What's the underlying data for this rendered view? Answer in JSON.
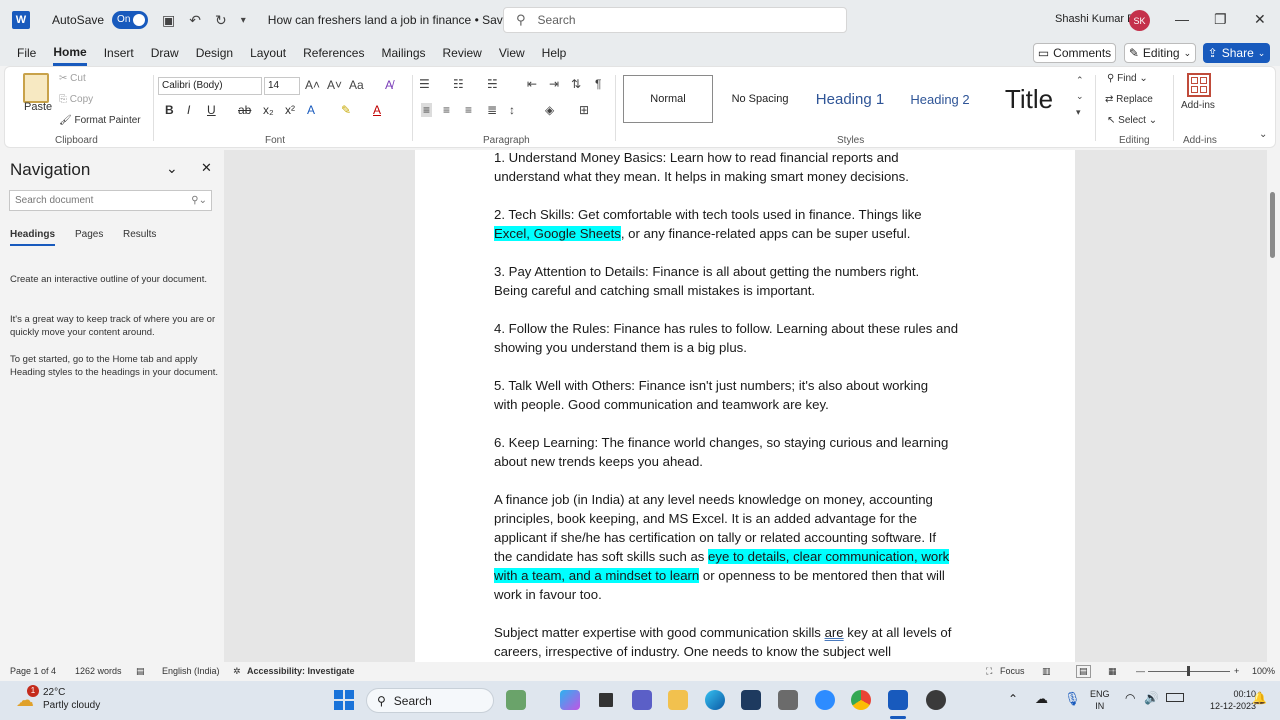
{
  "titlebar": {
    "app_icon": "W",
    "autosave_label": "AutoSave",
    "autosave_state": "On",
    "document_title": "How can freshers land a job in finance • Saved ⌄",
    "search_placeholder": "Search",
    "user_name": "Shashi Kumar E",
    "user_initials": "SK"
  },
  "menu": {
    "tabs": [
      "File",
      "Home",
      "Insert",
      "Draw",
      "Design",
      "Layout",
      "References",
      "Mailings",
      "Review",
      "View",
      "Help"
    ],
    "active": "Home",
    "comments": "Comments",
    "editing": "Editing",
    "share": "Share"
  },
  "ribbon": {
    "clipboard": {
      "paste": "Paste",
      "cut": "Cut",
      "copy": "Copy",
      "format_painter": "Format Painter",
      "label": "Clipboard"
    },
    "font": {
      "name": "Calibri (Body)",
      "size": "14",
      "label": "Font"
    },
    "paragraph": {
      "label": "Paragraph"
    },
    "styles": {
      "items": [
        "Normal",
        "No Spacing",
        "Heading 1",
        "Heading 2",
        "Title"
      ],
      "label": "Styles"
    },
    "editing": {
      "find": "Find",
      "replace": "Replace",
      "select": "Select",
      "label": "Editing"
    },
    "addins": {
      "button": "Add-ins",
      "label": "Add-ins"
    }
  },
  "navigation": {
    "title": "Navigation",
    "search_placeholder": "Search document",
    "tabs": [
      "Headings",
      "Pages",
      "Results"
    ],
    "paragraphs": [
      "Create an interactive outline of your document.",
      "It's a great way to keep track of where you are or quickly move your content around.",
      "To get started, go to the Home tab and apply Heading styles to the headings in your document."
    ]
  },
  "document": {
    "p1": [
      "1. Understand Money Basics: Learn how to read financial reports and",
      "understand what they mean. It helps in making smart money decisions."
    ],
    "p2_line1": "2. Tech Skills: Get comfortable with tech tools used in finance. Things like",
    "p2_hl": "Excel, Google Sheets",
    "p2_rest": ", or any finance-related apps can be super useful.",
    "p3": [
      "3. Pay Attention to Details: Finance is all about getting the numbers right.",
      "Being careful and catching small mistakes is important."
    ],
    "p4": [
      "4. Follow the Rules: Finance has rules to follow. Learning about these rules and",
      "showing you understand them is a big plus."
    ],
    "p5": [
      "5. Talk Well with Others: Finance isn't just numbers; it's also about working",
      "with people. Good communication and teamwork are key."
    ],
    "p6": [
      "6. Keep Learning: The finance world changes, so staying curious and learning",
      "about new trends keeps you ahead."
    ],
    "p7_lines": [
      "A finance job (in India) at any level needs knowledge on money, accounting",
      "principles, book keeping, and MS Excel. It is an added advantage for the",
      "applicant if she/he has certification on tally or related accounting software. If"
    ],
    "p7_l4_pre": "the  candidate has soft skills such as ",
    "p7_l4_hl": " eye to details, clear communication, work",
    "p7_l5_hl": "with a team, and a mindset to learn",
    "p7_l5_rest": " or openness to be mentored then that will",
    "p7_l6": "work in favour too.",
    "p8_l1_pre": "Subject matter expertise with good communication skills ",
    "p8_l1_sq": "are",
    "p8_l1_post": " key at all levels of",
    "p8_l2": "careers, irrespective of industry. One needs to know the subject well"
  },
  "status": {
    "page": "Page 1 of 4",
    "words": "1262 words",
    "language": "English (India)",
    "accessibility": "Accessibility: Investigate",
    "focus": "Focus",
    "zoom": "100%"
  },
  "taskbar": {
    "temp": "22°C",
    "weather": "Partly cloudy",
    "badge": "1",
    "search": "Search",
    "lang_1": "ENG",
    "lang_2": "IN",
    "time": "00:10",
    "date": "12-12-2023"
  }
}
